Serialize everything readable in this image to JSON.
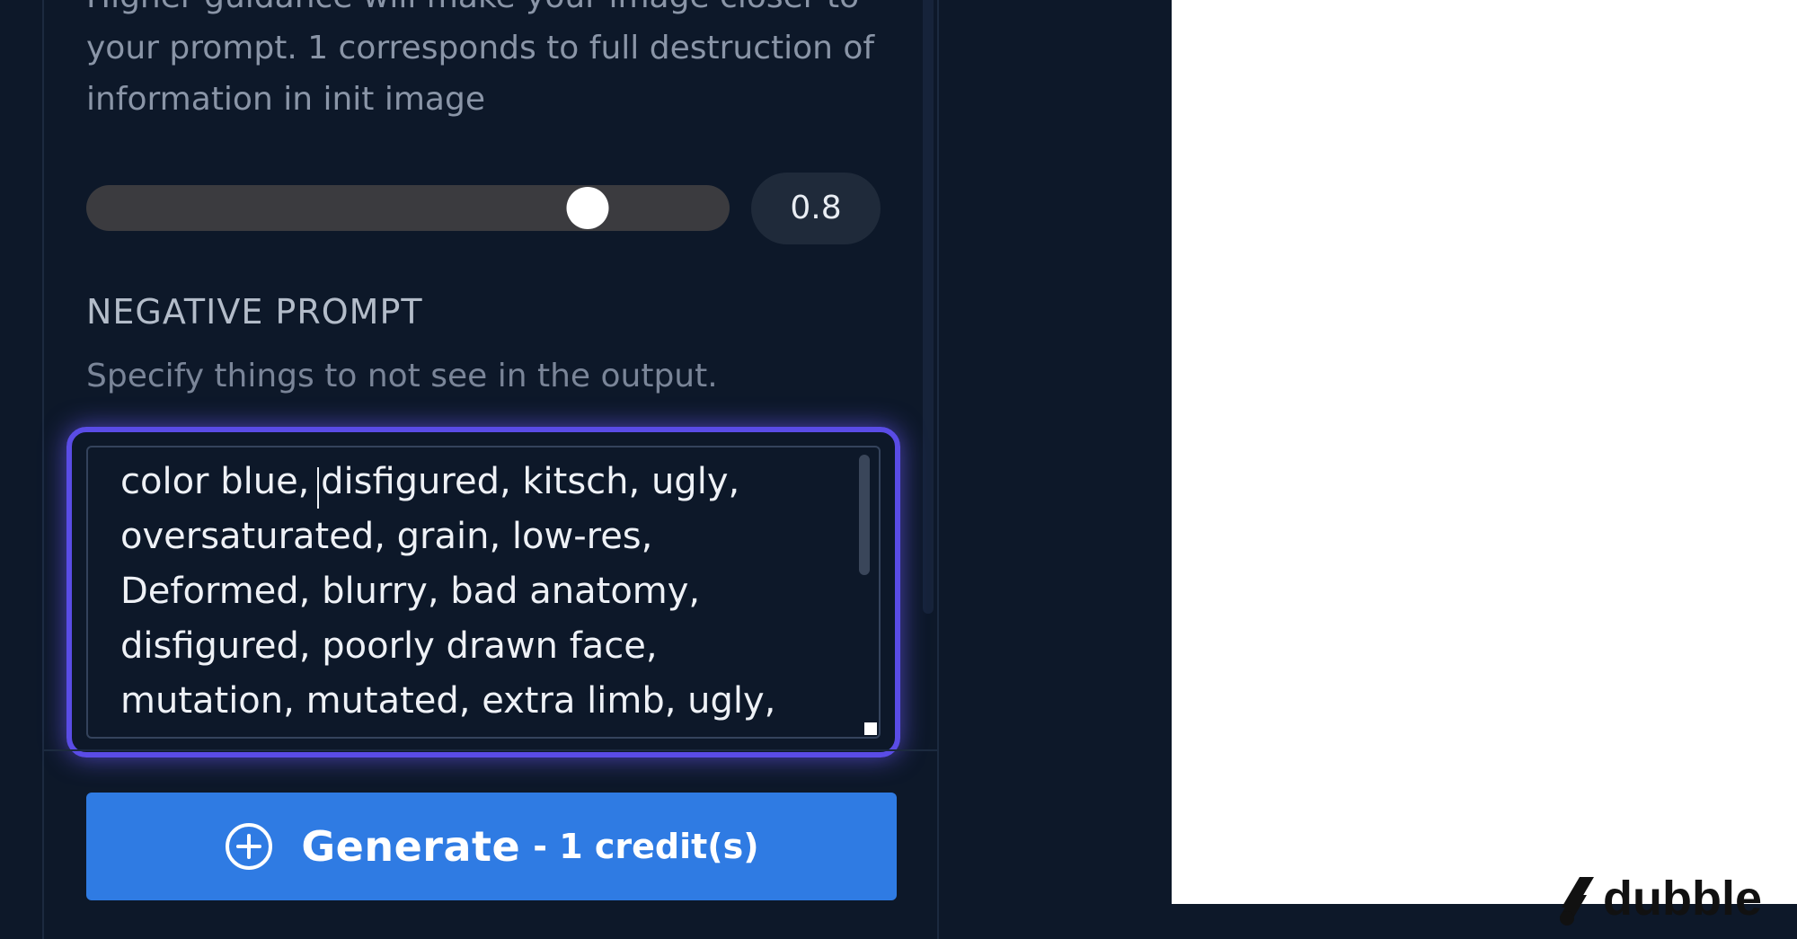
{
  "guidance": {
    "description_lines": [
      "Higher guidance will make your image closer to",
      "your prompt. 1 corresponds to full destruction of",
      "information in init image"
    ],
    "slider_value": 0.8,
    "slider_fraction": 0.78,
    "value_text": "0.8"
  },
  "negative_prompt": {
    "title": "NEGATIVE PROMPT",
    "help": "Specify things to not see in the output.",
    "lines": [
      "color blue, disfigured, kitsch, ugly,",
      "oversaturated, grain, low-res,",
      "Deformed, blurry, bad anatomy,",
      "disfigured, poorly drawn face,",
      "mutation, mutated, extra limb, ugly,"
    ]
  },
  "generate": {
    "label": "Generate",
    "credits": "- 1 credit(s)",
    "icon": "plus-circle-icon"
  },
  "watermark": {
    "brand": "dubble",
    "icon": "dubble-logo-icon"
  },
  "colors": {
    "background": "#0d1829",
    "focus_ring": "#5a4ce6",
    "button": "#2f7be3"
  }
}
